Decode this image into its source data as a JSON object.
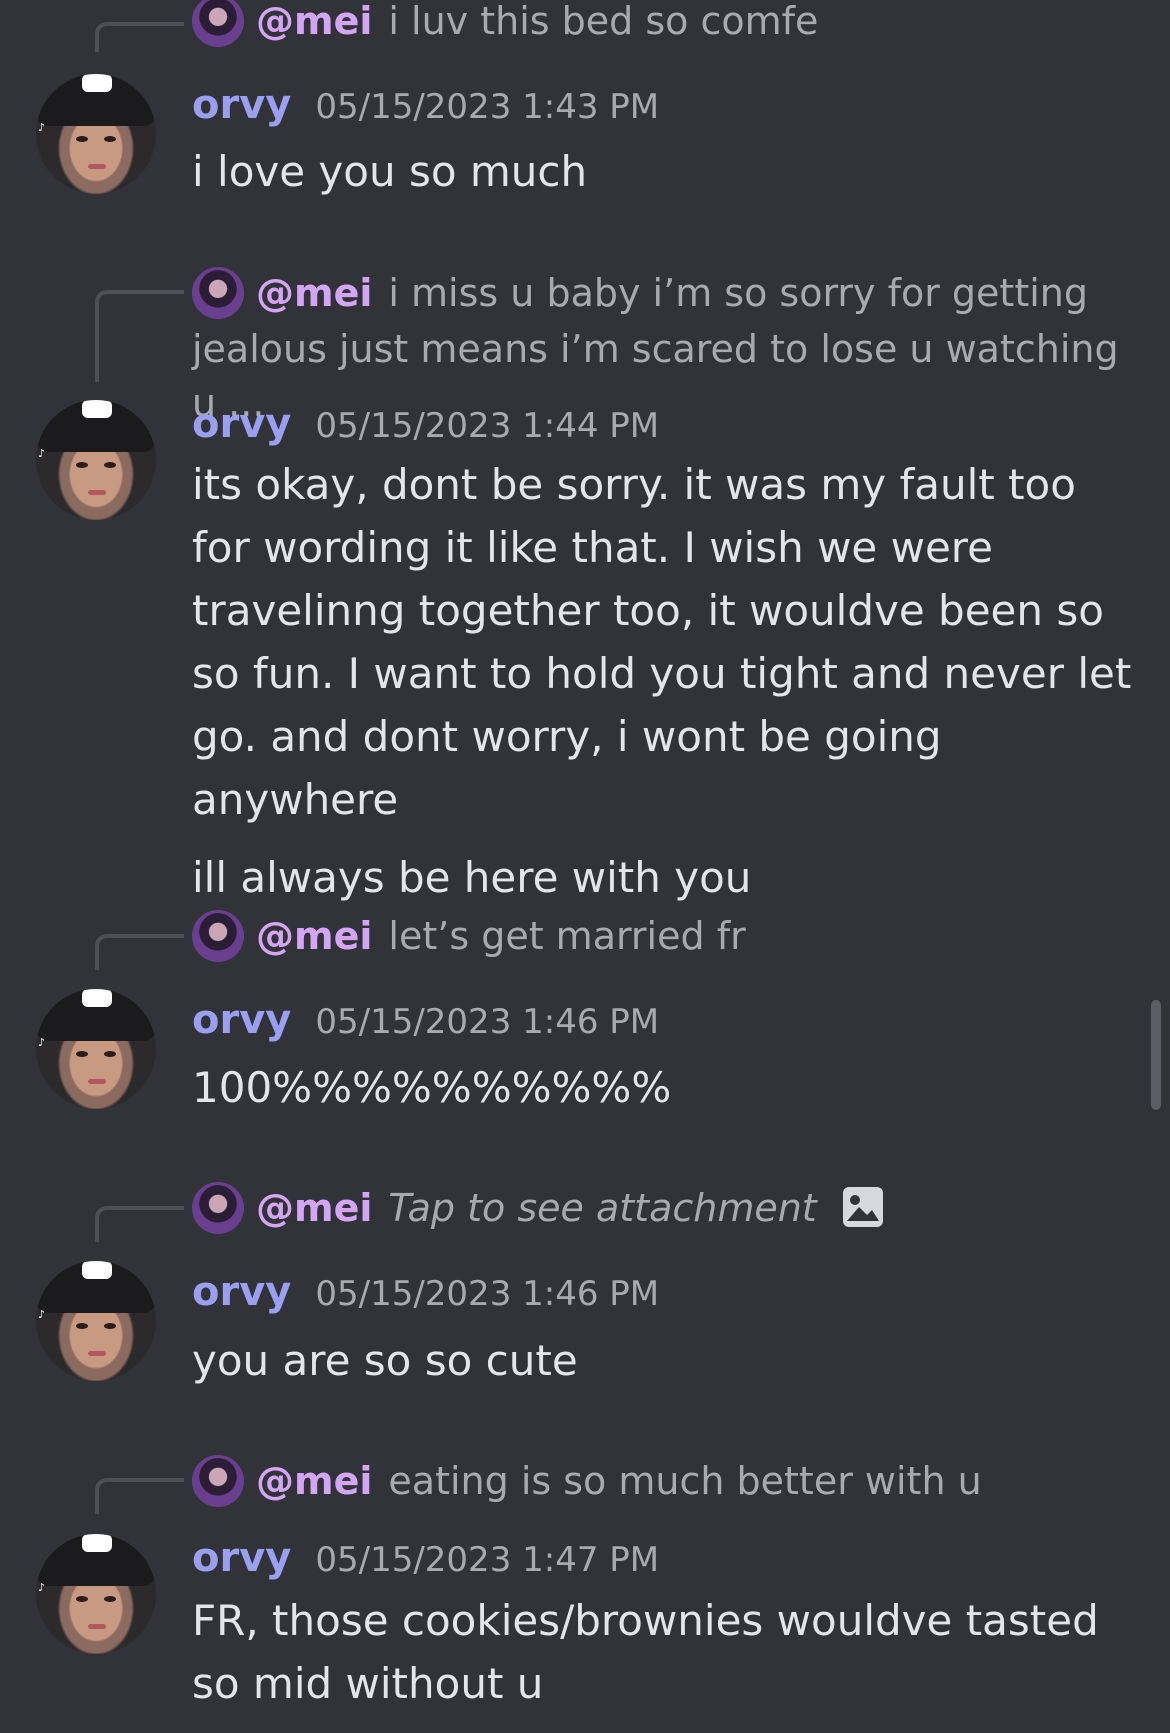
{
  "colors": {
    "background": "#313338",
    "username": "#9b9ff0",
    "mention": "#d4a4f5",
    "muted": "#a7aab0",
    "text": "#e3e5e8"
  },
  "messages": [
    {
      "reply": {
        "mention": "@mei",
        "text": "i luv this bed so comfe",
        "is_attachment": false
      },
      "author": "orvy",
      "timestamp": "05/15/2023 1:43 PM",
      "paragraphs": [
        "i love you so much"
      ]
    },
    {
      "reply": {
        "mention": "@mei",
        "text": "i miss u baby i’m so sorry for getting jealous just means i’m scared to lose u watching u ...",
        "is_attachment": false
      },
      "author": "orvy",
      "timestamp": "05/15/2023 1:44 PM",
      "paragraphs": [
        "its okay, dont be sorry. it was my fault too for wording it like that. I wish we were travelinng together too, it wouldve been so so fun. I want to hold you tight and never let go. and dont worry, i wont be going anywhere",
        "ill always be here with you"
      ]
    },
    {
      "reply": {
        "mention": "@mei",
        "text": "let’s get married fr",
        "is_attachment": false
      },
      "author": "orvy",
      "timestamp": "05/15/2023 1:46 PM",
      "paragraphs": [
        "100%%%%%%%%%%"
      ]
    },
    {
      "reply": {
        "mention": "@mei",
        "text": "Tap to see attachment",
        "is_attachment": true,
        "icon": "image-icon"
      },
      "author": "orvy",
      "timestamp": "05/15/2023 1:46 PM",
      "paragraphs": [
        "you are so so cute"
      ]
    },
    {
      "reply": {
        "mention": "@mei",
        "text": "eating is so much better with u",
        "is_attachment": false
      },
      "author": "orvy",
      "timestamp": "05/15/2023 1:47 PM",
      "paragraphs": [
        "FR, those cookies/brownies wouldve tasted so mid without u"
      ]
    }
  ]
}
